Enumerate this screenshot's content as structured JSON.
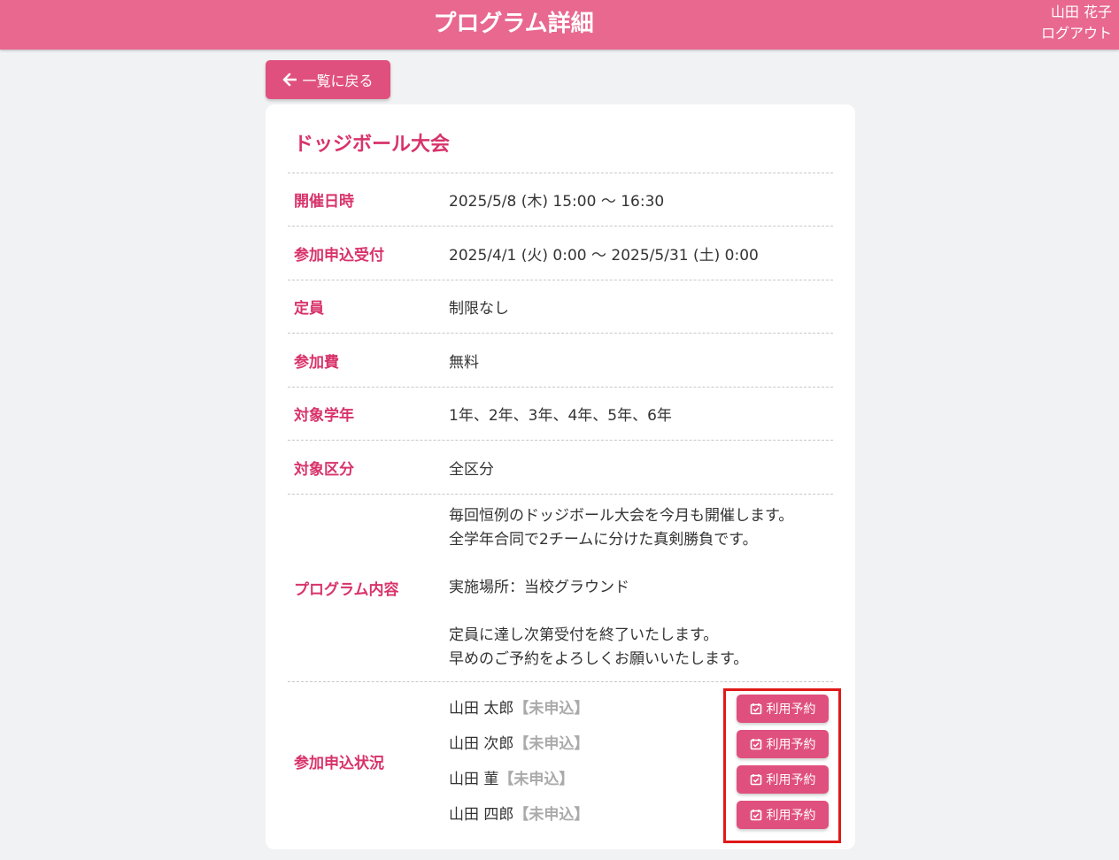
{
  "header": {
    "title": "プログラム詳細",
    "user_name": "山田 花子",
    "logout_label": "ログアウト"
  },
  "back_button": {
    "label": "一覧に戻る",
    "icon": "arrow-left-icon"
  },
  "program": {
    "title": "ドッジボール大会",
    "fields": [
      {
        "label": "開催日時",
        "value": "2025/5/8 (木) 15:00 〜 16:30"
      },
      {
        "label": "参加申込受付",
        "value": "2025/4/1 (火) 0:00 〜 2025/5/31 (土) 0:00"
      },
      {
        "label": "定員",
        "value": "制限なし"
      },
      {
        "label": "参加費",
        "value": "無料"
      },
      {
        "label": "対象学年",
        "value": "1年、2年、3年、4年、5年、6年"
      },
      {
        "label": "対象区分",
        "value": "全区分"
      }
    ],
    "description_label": "プログラム内容",
    "description_lines": [
      "毎回恒例のドッジボール大会を今月も開催します。",
      "全学年合同で2チームに分けた真剣勝負です。",
      "",
      "実施場所：当校グラウンド",
      "",
      "定員に達し次第受付を終了いたします。",
      "早めのご予約をよろしくお願いいたします。"
    ],
    "status_label": "参加申込状況",
    "participants": [
      {
        "name": "山田 太郎",
        "status": "【未申込】"
      },
      {
        "name": "山田 次郎",
        "status": "【未申込】"
      },
      {
        "name": "山田 菫",
        "status": "【未申込】"
      },
      {
        "name": "山田 四郎",
        "status": "【未申込】"
      }
    ],
    "reserve_label": "利用予約"
  },
  "colors": {
    "header": "#e86890",
    "accent": "#d8336b",
    "button": "#e0507e",
    "highlight_border": "#e01818"
  }
}
